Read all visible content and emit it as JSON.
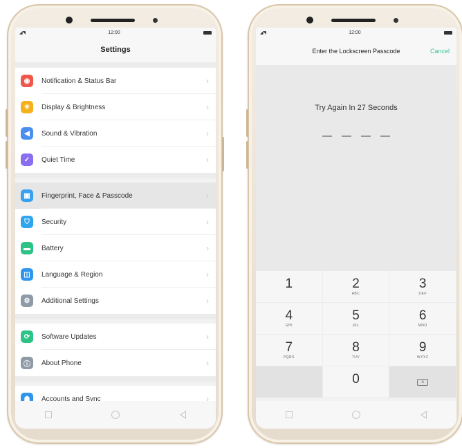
{
  "left_phone": {
    "status": {
      "time": "12:00"
    },
    "header": {
      "title": "Settings"
    },
    "groups": [
      [
        {
          "label": "Notification & Status Bar",
          "icon": "notification-icon",
          "color": "#f0564a"
        },
        {
          "label": "Display & Brightness",
          "icon": "brightness-icon",
          "color": "#f5b11b"
        },
        {
          "label": "Sound & Vibration",
          "icon": "sound-icon",
          "color": "#4a8ff0"
        },
        {
          "label": "Quiet Time",
          "icon": "moon-icon",
          "color": "#8a6ef0"
        }
      ],
      [
        {
          "label": "Fingerprint, Face & Passcode",
          "icon": "fingerprint-icon",
          "color": "#3aa0f0",
          "selected": true
        },
        {
          "label": "Security",
          "icon": "shield-icon",
          "color": "#2fa5f0"
        },
        {
          "label": "Battery",
          "icon": "battery-icon",
          "color": "#2dc386"
        },
        {
          "label": "Language & Region",
          "icon": "language-icon",
          "color": "#2f96f0"
        },
        {
          "label": "Additional Settings",
          "icon": "gear-icon",
          "color": "#8f9aa8"
        }
      ],
      [
        {
          "label": "Software Updates",
          "icon": "update-icon",
          "color": "#2dc386"
        },
        {
          "label": "About Phone",
          "icon": "info-icon",
          "color": "#8f9aa8"
        }
      ],
      [
        {
          "label": "Accounts and Sync",
          "icon": "account-icon",
          "color": "#2f96f0"
        }
      ]
    ]
  },
  "right_phone": {
    "status": {
      "time": "12:00"
    },
    "header": {
      "title": "Enter the Lockscreen Passcode",
      "cancel": "Cancel"
    },
    "message": "Try Again In 27 Seconds",
    "keys": [
      {
        "num": "1",
        "letters": ""
      },
      {
        "num": "2",
        "letters": "ABC"
      },
      {
        "num": "3",
        "letters": "DEF"
      },
      {
        "num": "4",
        "letters": "GHI"
      },
      {
        "num": "5",
        "letters": "JKL"
      },
      {
        "num": "6",
        "letters": "MNO"
      },
      {
        "num": "7",
        "letters": "PQRS"
      },
      {
        "num": "8",
        "letters": "TUV"
      },
      {
        "num": "9",
        "letters": "WXYZ"
      },
      {
        "num": "",
        "letters": ""
      },
      {
        "num": "0",
        "letters": ""
      },
      {
        "num": "",
        "letters": ""
      }
    ]
  },
  "colors": {
    "accent": "#3fc39a",
    "bezel": "#ece3d6"
  }
}
